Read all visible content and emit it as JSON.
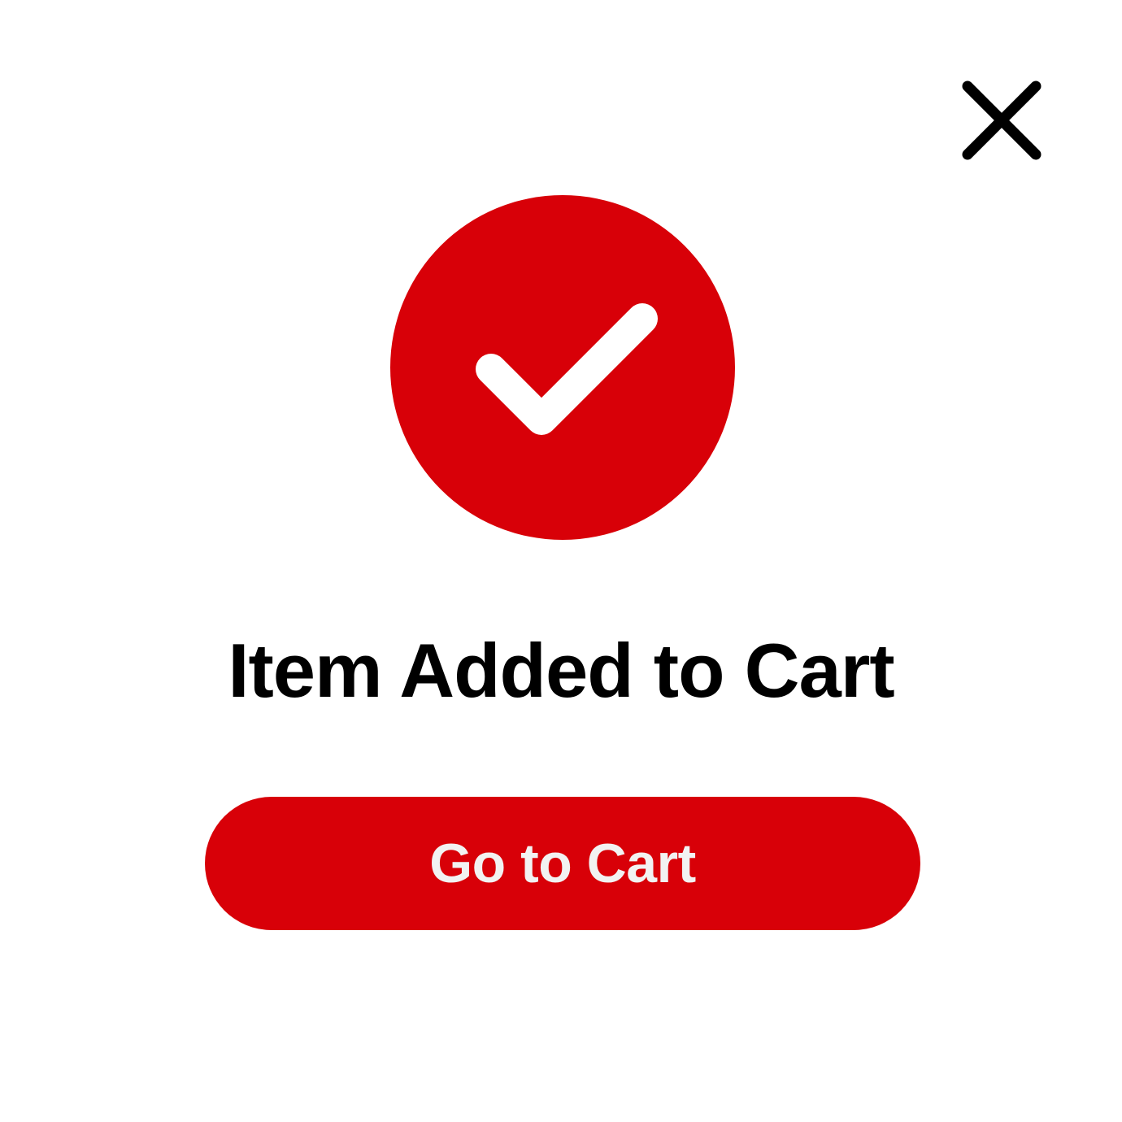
{
  "dialog": {
    "title": "Item Added to Cart",
    "primary_button_label": "Go to Cart",
    "close_icon": "close-icon",
    "status_icon": "checkmark-circle-icon"
  },
  "colors": {
    "accent": "#D80008",
    "background": "#FFFFFF",
    "text": "#000000",
    "button_text": "#F2F2F2",
    "icon": "#000000"
  }
}
